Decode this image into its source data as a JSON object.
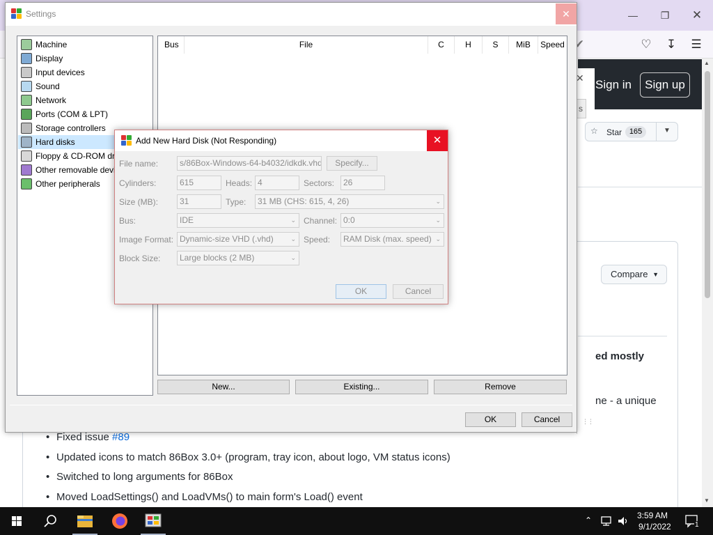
{
  "browser": {
    "header": {
      "sign_in": "Sign in",
      "sign_up": "Sign up"
    },
    "partial_tab": "s",
    "star": {
      "label": "Star",
      "count": "165"
    },
    "compare_label": "Compare",
    "fragment_bold": "ed mostly",
    "fragment_text": "ne - a unique",
    "bullets": [
      {
        "text": "Fixed issue ",
        "link": "#89"
      },
      {
        "text": "Updated icons to match 86Box 3.0+ (program, tray icon, about logo, VM status icons)"
      },
      {
        "text": "Switched to long arguments for 86Box"
      },
      {
        "text": "Moved LoadSettings() and LoadVMs() to main form's Load() event"
      }
    ]
  },
  "settings": {
    "title": "Settings",
    "categories": [
      {
        "label": "Machine",
        "icon": "machine-icon"
      },
      {
        "label": "Display",
        "icon": "display-icon"
      },
      {
        "label": "Input devices",
        "icon": "input-devices-icon"
      },
      {
        "label": "Sound",
        "icon": "sound-icon"
      },
      {
        "label": "Network",
        "icon": "network-icon"
      },
      {
        "label": "Ports (COM & LPT)",
        "icon": "ports-icon"
      },
      {
        "label": "Storage controllers",
        "icon": "storage-controllers-icon"
      },
      {
        "label": "Hard disks",
        "icon": "hard-disks-icon",
        "selected": true
      },
      {
        "label": "Floppy & CD-ROM drives",
        "icon": "floppy-cdrom-icon"
      },
      {
        "label": "Other removable devices",
        "icon": "removable-devices-icon"
      },
      {
        "label": "Other peripherals",
        "icon": "peripherals-icon"
      }
    ],
    "columns": [
      "Bus",
      "File",
      "C",
      "H",
      "S",
      "MiB",
      "Speed"
    ],
    "buttons": {
      "new": "New...",
      "existing": "Existing...",
      "remove": "Remove",
      "ok": "OK",
      "cancel": "Cancel"
    }
  },
  "dialog": {
    "title": "Add New Hard Disk (Not Responding)",
    "file_name_label": "File name:",
    "file_name_value": "s/86Box-Windows-64-b4032/idkdk.vhd",
    "specify_label": "Specify...",
    "cylinders_label": "Cylinders:",
    "cylinders_value": "615",
    "heads_label": "Heads:",
    "heads_value": "4",
    "sectors_label": "Sectors:",
    "sectors_value": "26",
    "size_label": "Size (MB):",
    "size_value": "31",
    "type_label": "Type:",
    "type_value": "31 MB (CHS: 615, 4, 26)",
    "bus_label": "Bus:",
    "bus_value": "IDE",
    "channel_label": "Channel:",
    "channel_value": "0:0",
    "image_format_label": "Image Format:",
    "image_format_value": "Dynamic-size VHD (.vhd)",
    "speed_label": "Speed:",
    "speed_value": "RAM Disk (max. speed)",
    "block_size_label": "Block Size:",
    "block_size_value": "Large blocks (2 MB)",
    "ok_label": "OK",
    "cancel_label": "Cancel"
  },
  "taskbar": {
    "time": "3:59 AM",
    "date": "9/1/2022",
    "notification_count": "1",
    "apps": [
      "file-explorer-icon",
      "firefox-icon",
      "86box-icon"
    ]
  },
  "colors": {
    "browser_titlebar": "#e3daf2",
    "github_header": "#24292f",
    "selection": "#cce8ff",
    "dialog_close": "#e81123",
    "taskbar": "#101010"
  }
}
